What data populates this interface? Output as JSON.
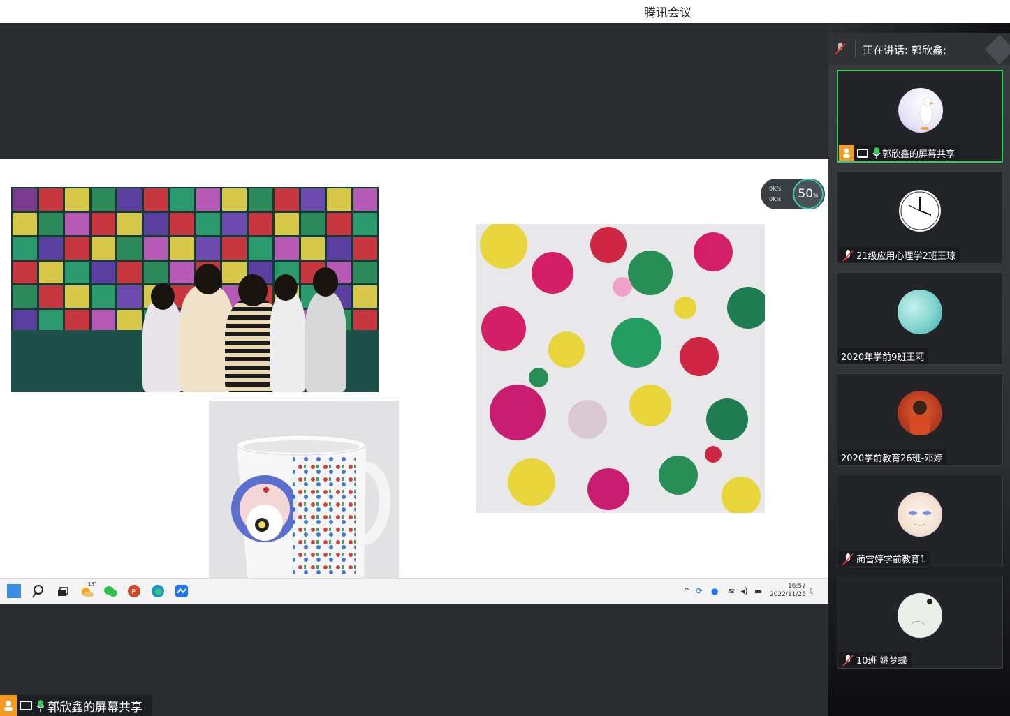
{
  "window": {
    "title": "腾讯会议"
  },
  "speaking": {
    "label": "正在讲话: 郭欣鑫;"
  },
  "network": {
    "up": "0K/s",
    "down": "0K/s",
    "cpu_percent": "50",
    "cpu_unit": "%"
  },
  "taskbar": {
    "weather_temp": "18°",
    "time": "16:57",
    "date": "2022/11/25"
  },
  "share_tag": {
    "label": "郭欣鑫的屏幕共享"
  },
  "participants": [
    {
      "name": "郭欣鑫的屏幕共享",
      "muted": false,
      "sharing": true,
      "avatar": "goose-avatar"
    },
    {
      "name": "21级应用心理学2班王琼",
      "muted": true,
      "sharing": false,
      "avatar": "clock-avatar"
    },
    {
      "name": "2020年学前9班王莉",
      "muted": false,
      "sharing": false,
      "avatar": "teal-shape-avatar"
    },
    {
      "name": "2020学前教育26班-邓婷",
      "muted": false,
      "sharing": false,
      "avatar": "photo-avatar"
    },
    {
      "name": "蔺雪婷学前教育1",
      "muted": true,
      "sharing": false,
      "avatar": "anime-avatar"
    },
    {
      "name": "10班 姚梦蝶",
      "muted": true,
      "sharing": false,
      "avatar": "sketch-avatar"
    }
  ],
  "colors": {
    "active_speaker": "#2ed15e",
    "share_badge": "#f59a23",
    "mic_green": "#2ed15e",
    "mute_red": "#e53935"
  }
}
